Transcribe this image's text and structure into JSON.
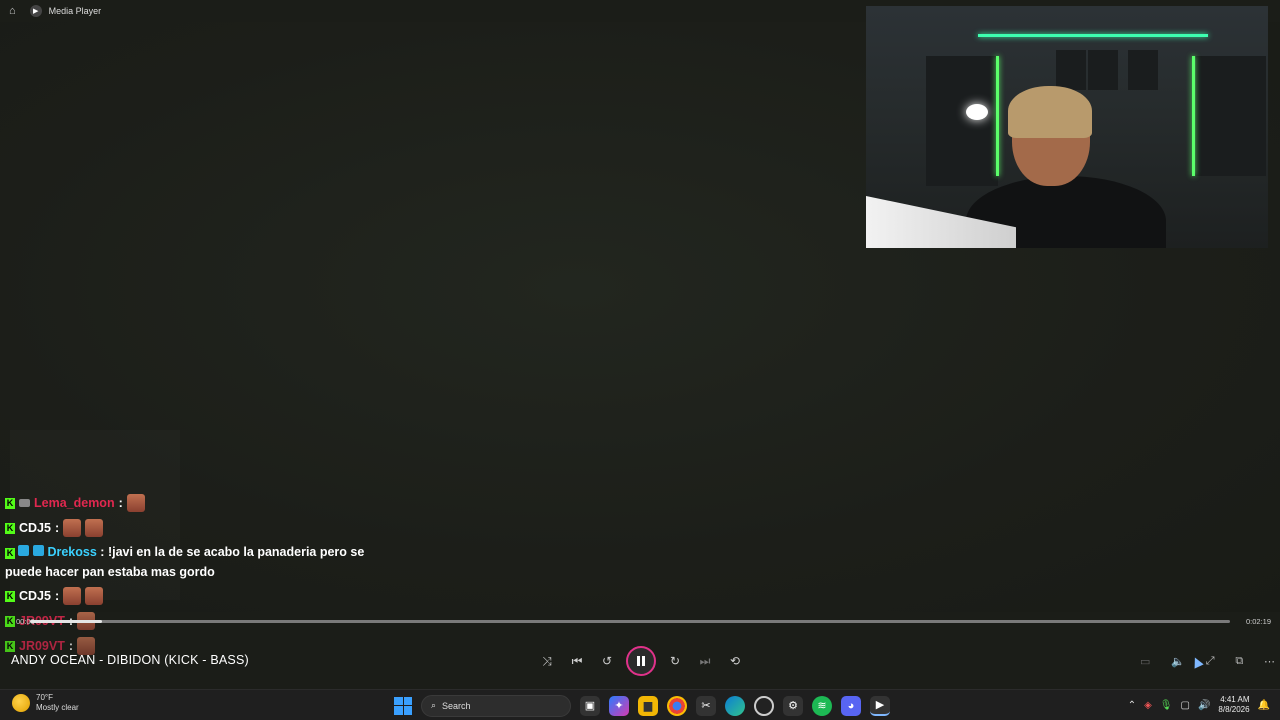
{
  "titlebar": {
    "app_name": "Media Player"
  },
  "chat": {
    "messages": [
      {
        "user": "Lema_demon",
        "sep": ":",
        "text": ""
      },
      {
        "user": "CDJ5",
        "sep": ":",
        "text": ""
      },
      {
        "user": "Drekoss",
        "sep": ":",
        "text": "!javi en la de se acabo la panaderia pero se puede hacer pan estaba mas gordo"
      },
      {
        "user": "CDJ5",
        "sep": ":",
        "text": ""
      },
      {
        "user": "JR09VT",
        "sep": ":",
        "text": ""
      },
      {
        "user": "JR09VT",
        "sep": ":",
        "text": ""
      }
    ]
  },
  "player": {
    "elapsed": "00:00",
    "duration": "0:02:19",
    "progress_fraction": 0.06,
    "song_title": "ANDY OCEAN - DIBIDON (KICK - BASS)",
    "accent_color": "#e0328a"
  },
  "taskbar": {
    "weather_temp": "70°F",
    "weather_desc": "Mostly clear",
    "search_placeholder": "Search",
    "time": "4:41 AM",
    "date": "8/8/2026"
  }
}
